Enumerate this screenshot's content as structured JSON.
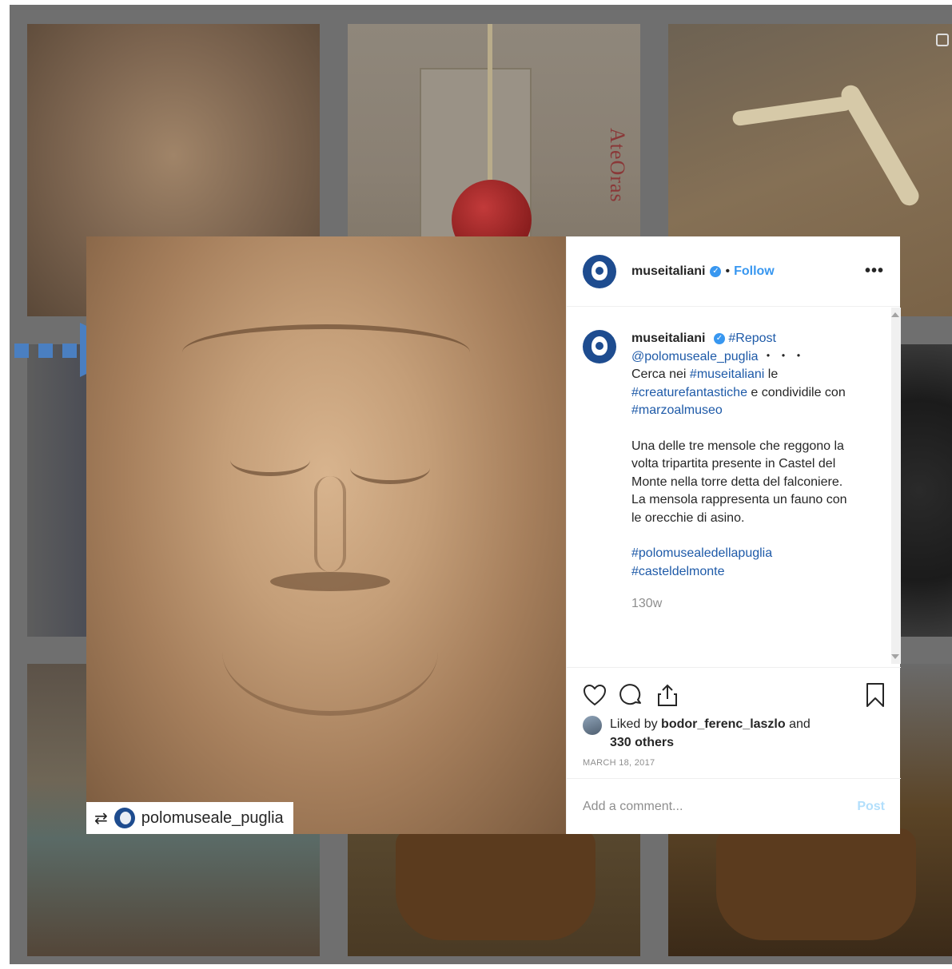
{
  "background_grid": {
    "tile_side_text": "AteOras"
  },
  "post": {
    "username": "museitaliani",
    "verified_icon": "verified-badge-icon",
    "separator": "•",
    "follow_label": "Follow",
    "more_label": "•••",
    "repost_username": "polomuseale_puglia",
    "caption": {
      "username": "museitaliani",
      "repost_tag": "#Repost",
      "mention": "@polomuseale_puglia",
      "ellipsis": "・・・",
      "line1_pre": "Cerca nei ",
      "tag_museitaliani": "#museitaliani",
      "line1_post": " le ",
      "tag_creature": "#creaturefantastiche",
      "line2_mid": " e condividile con ",
      "tag_marzo": "#marzoalmuseo",
      "paragraph": "Una delle tre mensole che reggono la volta tripartita presente in Castel del Monte nella torre detta del falconiere. La mensola rappresenta un fauno con le orecchie di asino.",
      "tag_polo": "#polomusealedellapuglia",
      "tag_castel": "#casteldelmonte",
      "time": "130w"
    },
    "likes": {
      "prefix": "Liked by ",
      "user": "bodor_ferenc_laszlo",
      "mid": " and ",
      "others": "330 others"
    },
    "date": "MARCH 18, 2017",
    "comment_placeholder": "Add a comment...",
    "post_label": "Post"
  },
  "colors": {
    "accent": "#3897f0",
    "hashtag": "#1e5aa8",
    "arrow": "#4a7fc1"
  }
}
